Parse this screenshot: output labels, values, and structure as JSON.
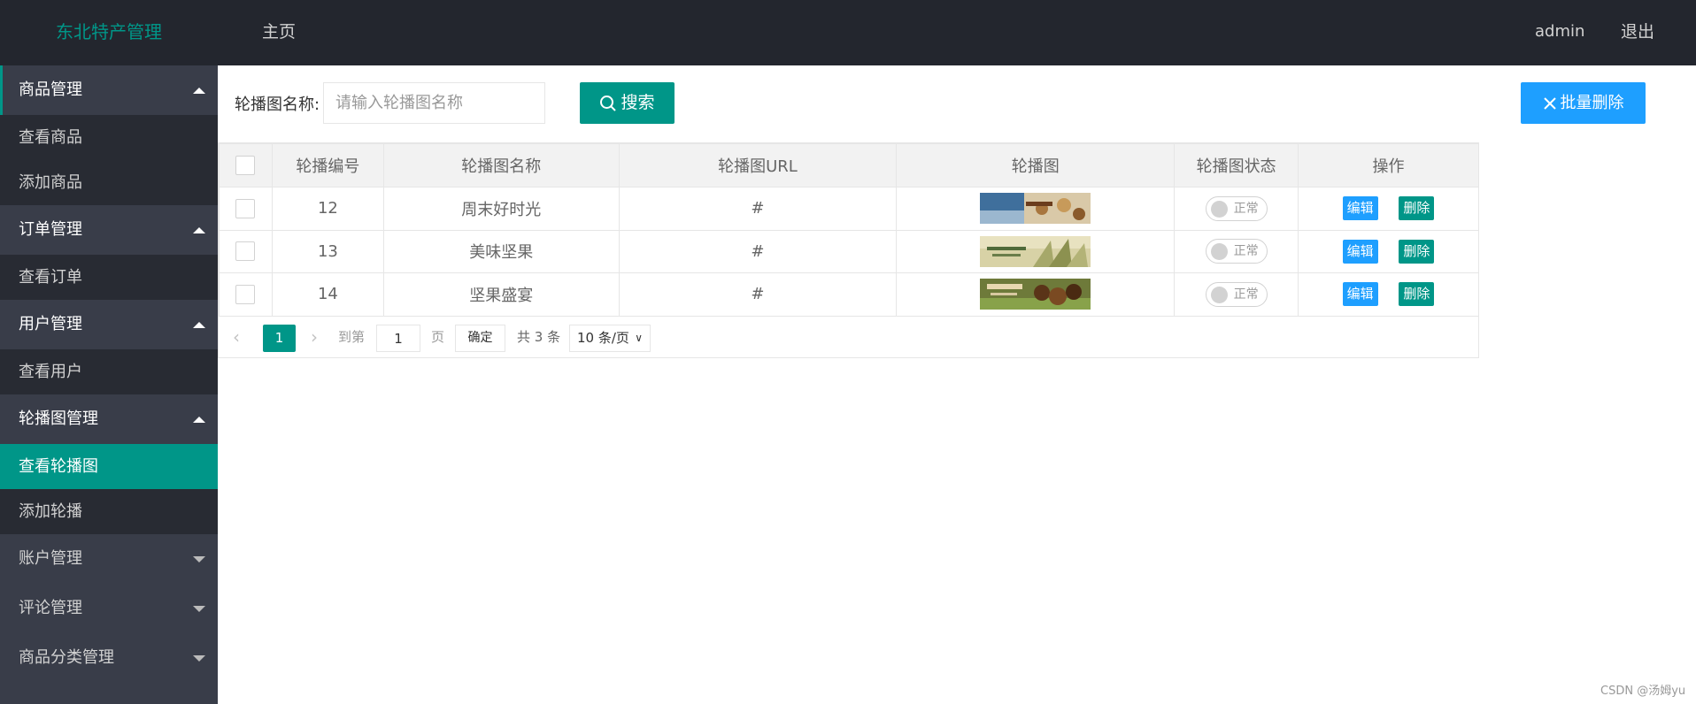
{
  "header": {
    "logo": "东北特产管理",
    "nav_home": "主页",
    "user": "admin",
    "logout": "退出"
  },
  "sidebar": {
    "groups": [
      {
        "title": "商品管理",
        "expanded": true,
        "items": [
          "查看商品",
          "添加商品"
        ]
      },
      {
        "title": "订单管理",
        "expanded": true,
        "items": [
          "查看订单"
        ]
      },
      {
        "title": "用户管理",
        "expanded": true,
        "items": [
          "查看用户"
        ]
      },
      {
        "title": "轮播图管理",
        "expanded": true,
        "items": [
          "查看轮播图",
          "添加轮播"
        ]
      },
      {
        "title": "账户管理",
        "expanded": false,
        "items": []
      },
      {
        "title": "评论管理",
        "expanded": false,
        "items": []
      },
      {
        "title": "商品分类管理",
        "expanded": false,
        "items": []
      }
    ],
    "selected_item": "查看轮播图"
  },
  "toolbar": {
    "search_label": "轮播图名称:",
    "search_placeholder": "请输入轮播图名称",
    "search_button": "搜索",
    "batch_delete_button": "批量删除"
  },
  "table": {
    "headers": [
      "轮播编号",
      "轮播图名称",
      "轮播图URL",
      "轮播图",
      "轮播图状态",
      "操作"
    ],
    "rows": [
      {
        "id": "12",
        "name": "周末好时光",
        "url": "#",
        "status": "正常"
      },
      {
        "id": "13",
        "name": "美味坚果",
        "url": "#",
        "status": "正常"
      },
      {
        "id": "14",
        "name": "坚果盛宴",
        "url": "#",
        "status": "正常"
      }
    ],
    "edit_label": "编辑",
    "delete_label": "删除"
  },
  "pagination": {
    "current_page": "1",
    "goto_label": "到第",
    "goto_value": "1",
    "page_unit": "页",
    "confirm": "确定",
    "total": "共 3 条",
    "page_size": "10 条/页"
  },
  "watermark": "CSDN @汤姆yu",
  "colors": {
    "primary": "#009688",
    "blue": "#1e9fff",
    "header_bg": "#23262e",
    "sidebar_bg": "#393d49"
  }
}
